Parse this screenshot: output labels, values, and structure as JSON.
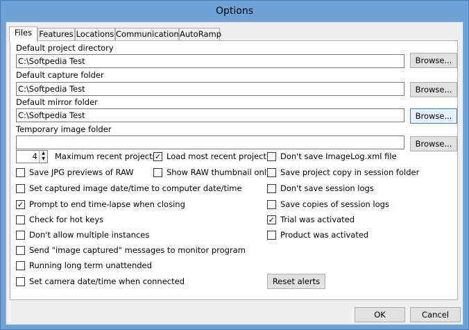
{
  "window": {
    "title": "Options"
  },
  "tabs": [
    "Files",
    "Features",
    "Locations",
    "Communications",
    "AutoRamp"
  ],
  "folders": [
    {
      "label": "Default project directory",
      "value": "C:\\Softpedia Test",
      "button": "Browse..."
    },
    {
      "label": "Default capture folder",
      "value": "C:\\Softpedia Test",
      "button": "Browse..."
    },
    {
      "label": "Default mirror folder",
      "value": "C:\\Softpedia Test",
      "button": "Browse..."
    },
    {
      "label": "Temporary image folder",
      "value": "",
      "button": "Browse..."
    }
  ],
  "recent": {
    "value": "4",
    "label": "Maximum recent projects"
  },
  "col1": [
    {
      "label": "Save JPG previews of RAW",
      "checked": false
    },
    {
      "label": "Set captured image date/time to computer date/time",
      "checked": false
    },
    {
      "label": "Prompt to end time-lapse when closing",
      "checked": true
    },
    {
      "label": "Check for hot keys",
      "checked": false
    },
    {
      "label": "Don't allow multiple instances",
      "checked": false
    },
    {
      "label": "Send \"image captured\" messages to monitor program",
      "checked": false
    },
    {
      "label": "Running long term unattended",
      "checked": false
    },
    {
      "label": "Set camera date/time when connected",
      "checked": false
    }
  ],
  "col2": [
    {
      "label": "Load most recent project",
      "checked": true
    },
    {
      "label": "Show RAW thumbnail only",
      "checked": false
    }
  ],
  "col3": [
    {
      "label": "Don't save ImageLog.xml file",
      "checked": false
    },
    {
      "label": "Save project copy in session folder",
      "checked": false
    },
    {
      "label": "Don't save session logs",
      "checked": false
    },
    {
      "label": "Save copies of session logs",
      "checked": false
    },
    {
      "label": "Trial was activated",
      "checked": true
    },
    {
      "label": "Product was activated",
      "checked": false
    }
  ],
  "reset_label": "Reset alerts",
  "footer": {
    "ok": "OK",
    "cancel": "Cancel"
  }
}
